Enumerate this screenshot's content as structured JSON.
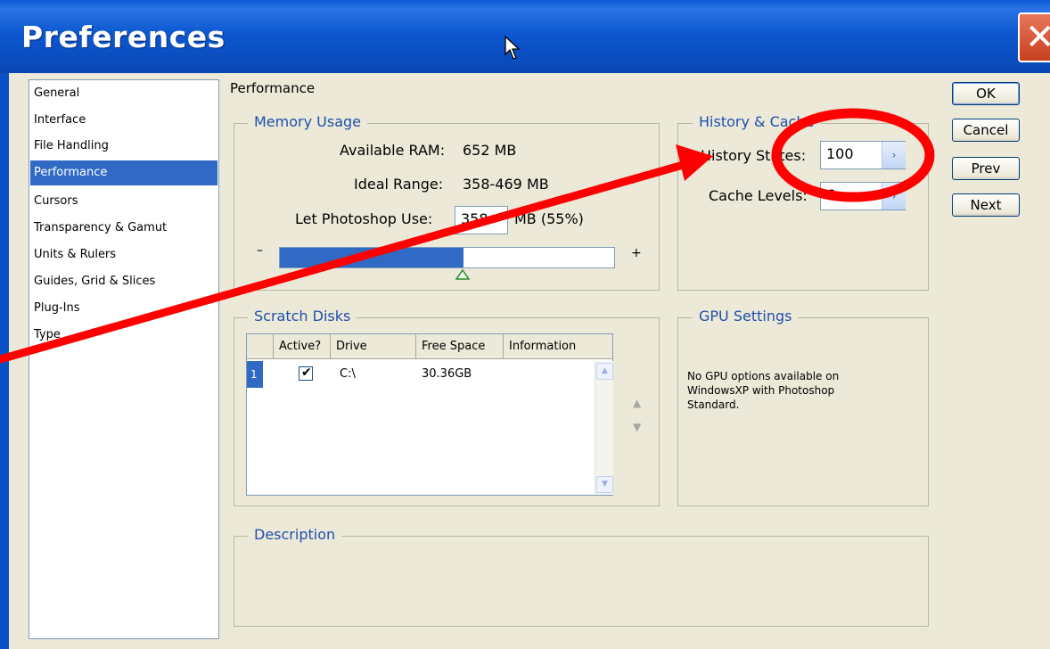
{
  "window": {
    "title": "Preferences",
    "close_glyph": "✕"
  },
  "sidebar": {
    "items": [
      {
        "label": "General"
      },
      {
        "label": "Interface"
      },
      {
        "label": "File Handling"
      },
      {
        "label": "Performance",
        "selected": true
      },
      {
        "label": "Cursors"
      },
      {
        "label": "Transparency & Gamut"
      },
      {
        "label": "Units & Rulers"
      },
      {
        "label": "Guides, Grid & Slices"
      },
      {
        "label": "Plug-Ins"
      },
      {
        "label": "Type"
      }
    ]
  },
  "page": {
    "title": "Performance"
  },
  "memory": {
    "group_title": "Memory Usage",
    "available_label": "Available RAM:",
    "available_value": "652 MB",
    "ideal_label": "Ideal Range:",
    "ideal_value": "358-469 MB",
    "use_label": "Let Photoshop Use:",
    "use_value": "358",
    "use_suffix": "MB (55%)",
    "minus": "–",
    "plus": "+",
    "slider_fraction": 0.55
  },
  "history_cache": {
    "group_title": "History & Cache",
    "history_label": "History States:",
    "history_value": "100",
    "cache_label": "Cache Levels:",
    "cache_value": "6"
  },
  "scratch": {
    "group_title": "Scratch Disks",
    "columns": [
      "",
      "Active?",
      "Drive",
      "Free Space",
      "Information"
    ],
    "rows": [
      {
        "index": "1",
        "active": "✔",
        "drive": "C:\\",
        "free": "30.36GB",
        "info": ""
      }
    ],
    "up_arrow": "▲",
    "down_arrow": "▼"
  },
  "gpu": {
    "group_title": "GPU Settings",
    "message_line1": "No GPU options available on",
    "message_line2": "WindowsXP with Photoshop",
    "message_line3": "Standard."
  },
  "description": {
    "group_title": "Description"
  },
  "buttons": {
    "ok": "OK",
    "cancel": "Cancel",
    "prev": "Prev",
    "next": "Next"
  },
  "colors": {
    "title_bar": "#0a4ec2",
    "selection": "#316ac5",
    "group_title": "#1f4fad",
    "annotation": "#ff0000"
  }
}
